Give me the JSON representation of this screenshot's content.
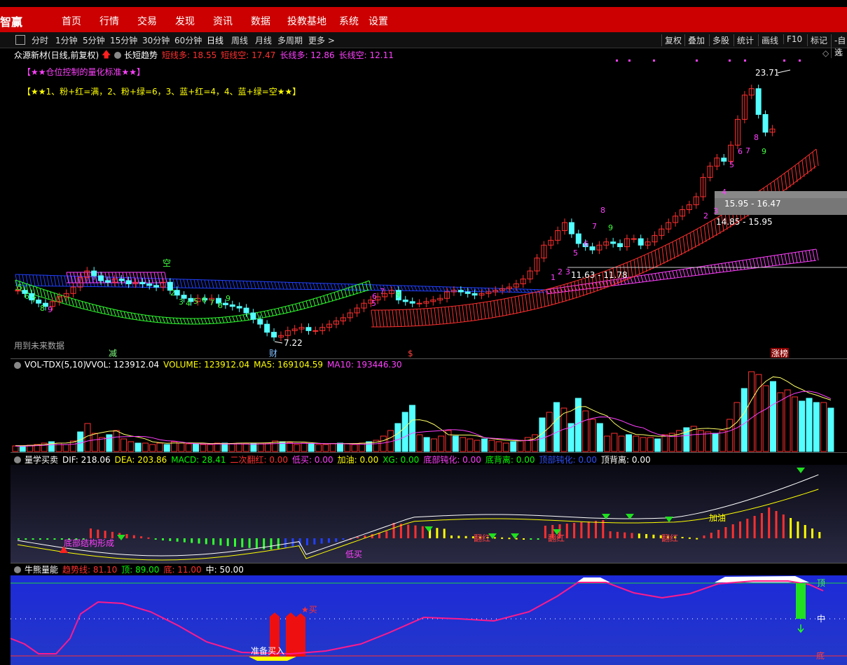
{
  "app": {
    "brand": "智赢"
  },
  "nav": [
    "首页",
    "行情",
    "交易",
    "发现",
    "资讯",
    "数据",
    "投教基地",
    "系统",
    "设置"
  ],
  "toolbar": {
    "periods": [
      "分时",
      "1分钟",
      "5分钟",
      "15分钟",
      "30分钟",
      "60分钟",
      "日线",
      "周线",
      "月线",
      "多周期",
      "更多 >"
    ],
    "active": "日线",
    "right": [
      "复权",
      "叠加",
      "多股",
      "统计",
      "画线",
      "F10",
      "标记",
      "-自选"
    ]
  },
  "main_panel": {
    "title": "众源新材(日线,前复权)",
    "indicator": "长短趋势",
    "params": [
      {
        "label": "短线多: 18.55",
        "color": "#ff3030"
      },
      {
        "label": "短线空: 17.47",
        "color": "#ff3030"
      },
      {
        "label": "长线多: 12.86",
        "color": "#ff40ff"
      },
      {
        "label": "长线空: 12.11",
        "color": "#ff40ff"
      }
    ],
    "note1": "【★★仓位控制的量化标准★★】",
    "note2": "【★★1、粉+红=满，2、粉+绿=6，3、蓝+红=4，4、蓝+绿=空★★】",
    "future_note": "用到未来数据",
    "price_high": "23.71",
    "price_low": "7.22",
    "zones": [
      "15.95 - 16.47",
      "14.85 - 15.95",
      "11.63 - 11.78"
    ],
    "bottom_labels": [
      "减",
      "财",
      "$",
      "涨榜"
    ],
    "kong_label": "空"
  },
  "vol_panel": {
    "title": "VOL-TDX(5,10)",
    "params": [
      {
        "label": "VVOL: 123912.04",
        "color": "#ffffff"
      },
      {
        "label": "VOLUME: 123912.04",
        "color": "#ffff00"
      },
      {
        "label": "MA5: 169104.59",
        "color": "#ffff00"
      },
      {
        "label": "MA10: 193446.30",
        "color": "#ff40ff"
      }
    ]
  },
  "macd_panel": {
    "title": "量学买卖",
    "params": [
      {
        "label": "DIF: 218.06",
        "color": "#ffffff"
      },
      {
        "label": "DEA: 203.86",
        "color": "#ffff00"
      },
      {
        "label": "MACD: 28.41",
        "color": "#00ff00"
      },
      {
        "label": "二次翻红: 0.00",
        "color": "#ff3030"
      },
      {
        "label": "低买: 0.00",
        "color": "#ff40ff"
      },
      {
        "label": "加油: 0.00",
        "color": "#ffff00"
      },
      {
        "label": "XG: 0.00",
        "color": "#00ff00"
      },
      {
        "label": "底部钝化: 0.00",
        "color": "#ff40ff"
      },
      {
        "label": "底背离: 0.00",
        "color": "#00ff00"
      },
      {
        "label": "顶部钝化: 0.00",
        "color": "#3050ff"
      },
      {
        "label": "顶背离: 0.00",
        "color": "#ffffff"
      }
    ],
    "labels": [
      "底部结构形成",
      "低买",
      "翻红",
      "翻红",
      "翻红",
      "加油"
    ]
  },
  "energy_panel": {
    "title": "牛熊量能",
    "params": [
      {
        "label": "趋势线: 81.10",
        "color": "#ff3030"
      },
      {
        "label": "顶: 89.00",
        "color": "#00ff00"
      },
      {
        "label": "底: 11.00",
        "color": "#ff3030"
      },
      {
        "label": "中: 50.00",
        "color": "#ffffff"
      }
    ],
    "labels": {
      "top": "顶",
      "mid": "中",
      "bottom": "底",
      "prepare": "准备买入",
      "buy": "买"
    }
  },
  "colors": {
    "up": "#ff3030",
    "down": "#54ffff",
    "accent": "#cc0000"
  }
}
